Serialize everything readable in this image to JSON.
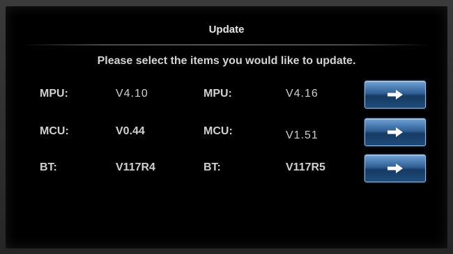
{
  "header": {
    "title": "Update",
    "prompt": "Please select the items you would like to update."
  },
  "rows": [
    {
      "current_label": "MPU:",
      "current_value": "V4.10",
      "new_label": "MPU:",
      "new_value": "V4.16",
      "action_icon": "arrow-right-icon"
    },
    {
      "current_label": "MCU:",
      "current_value": "V0.44",
      "new_label": "MCU:",
      "new_value": "V1.51",
      "action_icon": "arrow-right-icon"
    },
    {
      "current_label": "BT:",
      "current_value": "V117R4",
      "new_label": "BT:",
      "new_value": "V117R5",
      "action_icon": "arrow-right-icon"
    }
  ],
  "colors": {
    "background": "#000000",
    "text": "#d0d0d0",
    "button_top": "#6fa1d6",
    "button_bottom": "#163a63"
  }
}
